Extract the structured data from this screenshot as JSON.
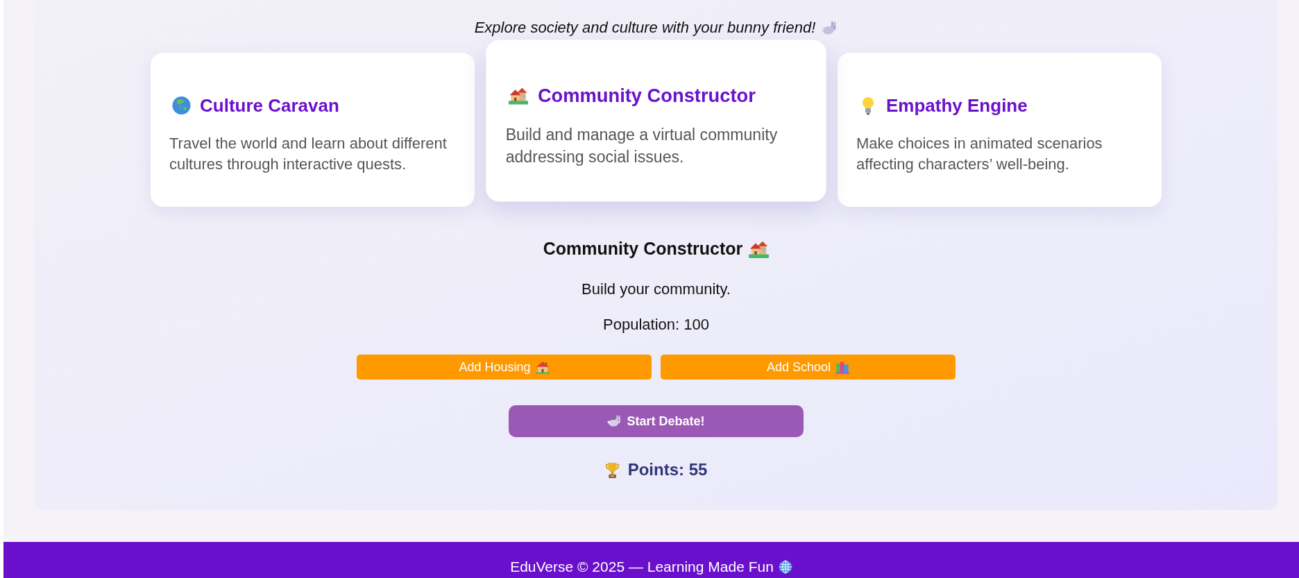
{
  "tagline": "Explore society and culture with your bunny friend!",
  "cards": [
    {
      "title": "Culture Caravan",
      "description": "Travel the world and learn about different cultures through interactive quests.",
      "selected": false
    },
    {
      "title": "Community Constructor",
      "description": "Build and manage a virtual community addressing social issues.",
      "selected": true
    },
    {
      "title": "Empathy Engine",
      "description": "Make choices in animated scenarios affecting characters’ well-being.",
      "selected": false
    }
  ],
  "game": {
    "title": "Community Constructor",
    "text": "Build your community.",
    "population": "Population: 100",
    "buttons": [
      {
        "label": "Add Housing"
      },
      {
        "label": "Add School"
      }
    ],
    "debate_button": "Start Debate!",
    "points": "Points: 55"
  },
  "footer": "EduVerse © 2025 — Learning Made Fun"
}
